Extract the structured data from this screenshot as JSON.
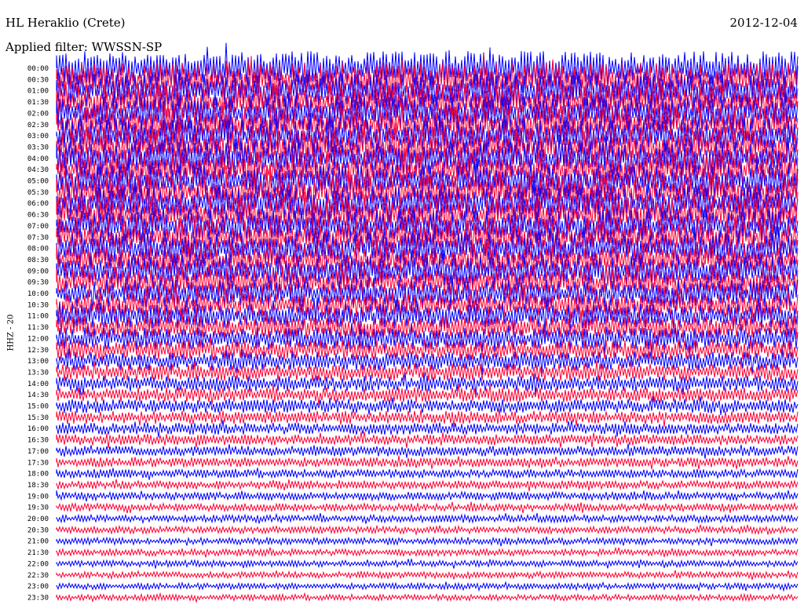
{
  "header": {
    "station": "HL Heraklio (Crete)",
    "date": "2012-12-04",
    "filter": "Applied filter: WWSSN-SP"
  },
  "channel_label": "HHZ - 20",
  "colors": {
    "trace_a": "#0000ff",
    "trace_b": "#ff0033",
    "text": "#000000",
    "background": "#ffffff"
  },
  "chart_data": {
    "type": "line",
    "ylabel": "HHZ - 20",
    "row_labels": [
      "00:00",
      "00:30",
      "01:00",
      "01:30",
      "02:00",
      "02:30",
      "03:00",
      "03:30",
      "04:00",
      "04:30",
      "05:00",
      "05:30",
      "06:00",
      "06:30",
      "07:00",
      "07:30",
      "08:00",
      "08:30",
      "09:00",
      "09:30",
      "10:00",
      "10:30",
      "11:00",
      "11:30",
      "12:00",
      "12:30",
      "13:00",
      "13:30",
      "14:00",
      "14:30",
      "15:00",
      "15:30",
      "16:00",
      "16:30",
      "17:00",
      "17:30",
      "18:00",
      "18:30",
      "19:00",
      "19:30",
      "20:00",
      "20:30",
      "21:00",
      "21:30",
      "22:00",
      "22:30",
      "23:00",
      "23:30"
    ],
    "row_colors": [
      "#0000ff",
      "#ff0033",
      "#0000ff",
      "#ff0033",
      "#0000ff",
      "#ff0033",
      "#0000ff",
      "#ff0033",
      "#0000ff",
      "#ff0033",
      "#0000ff",
      "#ff0033",
      "#0000ff",
      "#ff0033",
      "#0000ff",
      "#ff0033",
      "#0000ff",
      "#ff0033",
      "#0000ff",
      "#ff0033",
      "#0000ff",
      "#ff0033",
      "#0000ff",
      "#ff0033",
      "#0000ff",
      "#ff0033",
      "#0000ff",
      "#ff0033",
      "#0000ff",
      "#ff0033",
      "#0000ff",
      "#ff0033",
      "#0000ff",
      "#ff0033",
      "#0000ff",
      "#ff0033",
      "#0000ff",
      "#ff0033",
      "#0000ff",
      "#ff0033",
      "#0000ff",
      "#ff0033",
      "#0000ff",
      "#ff0033",
      "#0000ff",
      "#ff0033",
      "#0000ff",
      "#ff0033"
    ],
    "relative_amplitude": [
      1.0,
      1.0,
      0.98,
      0.98,
      0.97,
      0.97,
      0.96,
      0.96,
      0.95,
      0.95,
      0.94,
      0.94,
      0.93,
      0.93,
      0.92,
      0.9,
      0.88,
      0.86,
      0.84,
      0.82,
      0.8,
      0.76,
      0.72,
      0.68,
      0.64,
      0.6,
      0.55,
      0.5,
      0.46,
      0.43,
      0.4,
      0.38,
      0.35,
      0.32,
      0.3,
      0.28,
      0.26,
      0.25,
      0.24,
      0.23,
      0.22,
      0.21,
      0.2,
      0.2,
      0.19,
      0.19,
      0.18,
      0.18
    ]
  }
}
